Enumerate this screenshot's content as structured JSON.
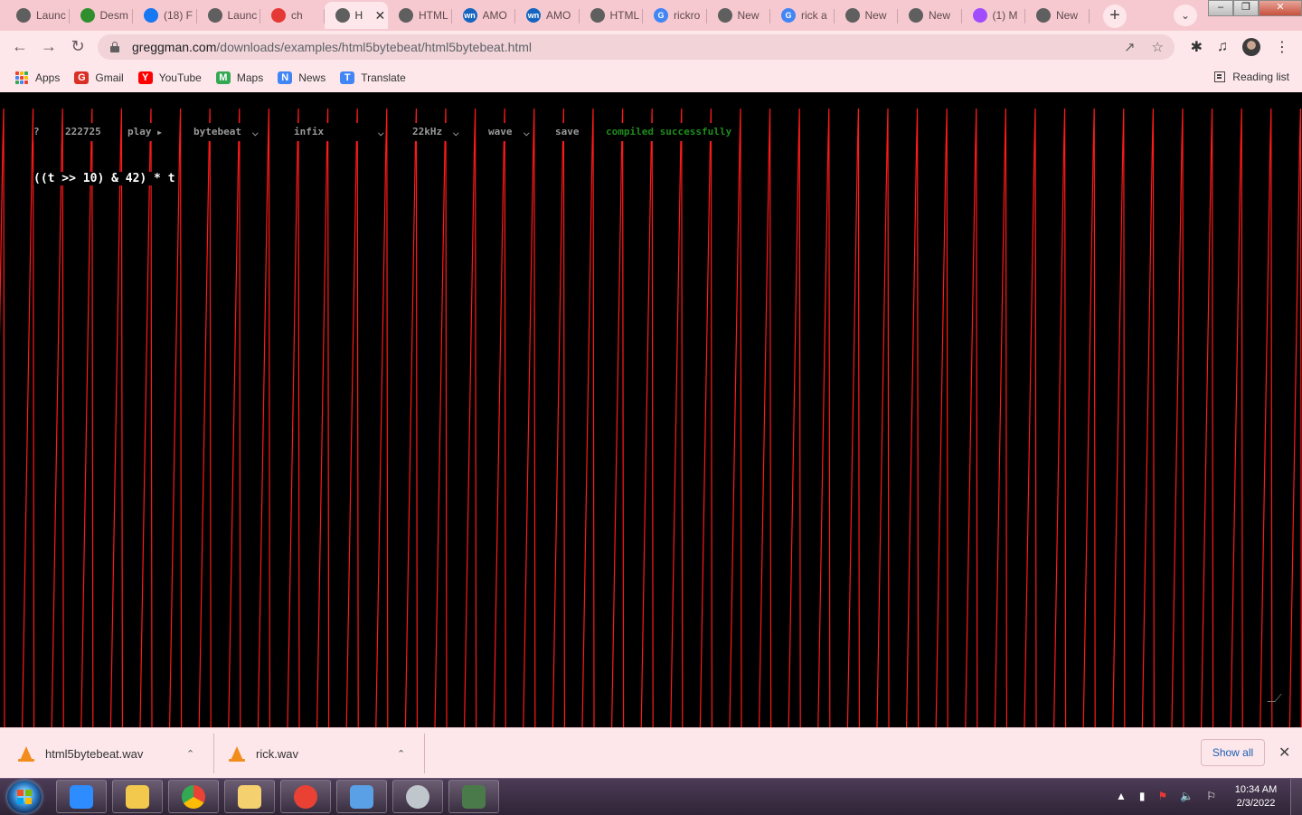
{
  "tabs": [
    {
      "title": "Launc",
      "favicon": "globe-icon",
      "color": "#5f5f5f"
    },
    {
      "title": "Desm",
      "favicon": "desmos-icon",
      "color": "#2f8f2f"
    },
    {
      "title": "(18) F",
      "favicon": "facebook-icon",
      "color": "#1877f2"
    },
    {
      "title": "Launc",
      "favicon": "globe-icon",
      "color": "#5f5f5f"
    },
    {
      "title": "ch",
      "favicon": "youtube-badge-icon",
      "color": "#e53935",
      "badge": "807"
    },
    {
      "title": "H",
      "favicon": "globe-icon",
      "color": "#5f5f5f",
      "active": true
    },
    {
      "title": "HTML",
      "favicon": "globe-icon",
      "color": "#5f5f5f"
    },
    {
      "title": "AMO",
      "favicon": "wn-icon",
      "color": "#1565c0",
      "label": "wn"
    },
    {
      "title": "AMO",
      "favicon": "wn-icon",
      "color": "#1565c0",
      "label": "wn"
    },
    {
      "title": "HTML",
      "favicon": "globe-icon",
      "color": "#5f5f5f"
    },
    {
      "title": "rickro",
      "favicon": "google-icon",
      "color": "#4285f4",
      "label": "G"
    },
    {
      "title": "New",
      "favicon": "chrome-icon",
      "color": "#5f5f5f"
    },
    {
      "title": "rick a",
      "favicon": "google-icon",
      "color": "#4285f4",
      "label": "G"
    },
    {
      "title": "New",
      "favicon": "chrome-icon",
      "color": "#5f5f5f"
    },
    {
      "title": "New",
      "favicon": "chrome-icon",
      "color": "#5f5f5f"
    },
    {
      "title": "(1) M",
      "favicon": "messenger-icon",
      "color": "#a24cff"
    },
    {
      "title": "New",
      "favicon": "chrome-icon",
      "color": "#5f5f5f"
    }
  ],
  "address": {
    "host": "greggman.com",
    "path": "/downloads/examples/html5bytebeat/html5bytebeat.html"
  },
  "bookmarks": [
    {
      "label": "Apps",
      "icon": "apps-grid-icon"
    },
    {
      "label": "Gmail",
      "icon": "gmail-icon",
      "color": "#d93025"
    },
    {
      "label": "YouTube",
      "icon": "youtube-icon",
      "color": "#ff0000"
    },
    {
      "label": "Maps",
      "icon": "maps-icon",
      "color": "#34a853"
    },
    {
      "label": "News",
      "icon": "news-icon",
      "color": "#4285f4"
    },
    {
      "label": "Translate",
      "icon": "translate-icon",
      "color": "#4285f4"
    }
  ],
  "reading_list": "Reading list",
  "bytebeat": {
    "help": "?",
    "time": "222725",
    "play": "play",
    "play_glyph": "▶",
    "mode": "bytebeat",
    "syntax": "infix",
    "rate": "22kHz",
    "vis": "wave",
    "save": "save",
    "status": "compiled successfully",
    "expression": "((t >> 10) & 42) * t",
    "wave_color": "#ff1a1a"
  },
  "downloads": [
    {
      "name": "html5bytebeat.wav",
      "icon": "vlc-icon"
    },
    {
      "name": "rick.wav",
      "icon": "vlc-icon"
    }
  ],
  "show_all": "Show all",
  "clock": {
    "time": "10:34 AM",
    "date": "2/3/2022"
  },
  "taskbar_apps": [
    {
      "name": "zoom-icon",
      "color": "#2d8cff"
    },
    {
      "name": "file-explorer-icon",
      "color": "#f2c94c"
    },
    {
      "name": "chrome-icon",
      "color": "#4caf50"
    },
    {
      "name": "folder-icon",
      "color": "#f4d06f"
    },
    {
      "name": "chrome-profile-icon",
      "color": "#e94235"
    },
    {
      "name": "control-panel-icon",
      "color": "#5aa0e6"
    },
    {
      "name": "disc-icon",
      "color": "#bfc6cc"
    },
    {
      "name": "terminal-icon",
      "color": "#4a7a4a"
    }
  ]
}
